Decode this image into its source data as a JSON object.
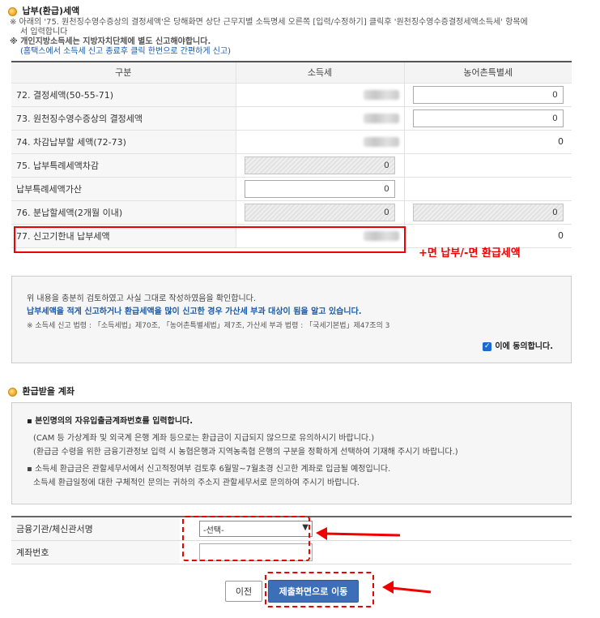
{
  "section1": {
    "title": "납부(환급)세액",
    "note1a": "※ 아래의 '75. 원천징수영수증상의 결정세액'은 당해화면 상단 근무지별 소득명세 오른쪽 [입력/수정하기] 클릭후 '원천징수영수증결정세액소득세' 항목에",
    "note1b": "서 입력합니다",
    "note2": "※ 개인지방소득세는 지방자치단체에 별도 신고해야합니다.",
    "note3": "(홈택스에서 소득세 신고 종료후 클릭 한번으로 간편하게 신고)"
  },
  "table": {
    "headers": [
      "구분",
      "소득세",
      "농어촌특별세"
    ],
    "rows": [
      {
        "label": "72. 결정세액(50-55-71)",
        "col3": "0"
      },
      {
        "label": "73. 원천징수영수증상의 결정세액",
        "col3": "0"
      },
      {
        "label": "74. 차감납부할 세액(72-73)",
        "col3": "0"
      },
      {
        "label": "75. 납부특례세액차감",
        "col2": "0"
      },
      {
        "label": "납부특례세액가산",
        "col2": "0"
      },
      {
        "label": "76. 분납할세액(2개월 이내)",
        "col2": "0",
        "col3": "0"
      },
      {
        "label": "77. 신고기한내 납부세액",
        "col3": "0"
      }
    ]
  },
  "annotation_note": "+면 납부/-면 환급세액",
  "confirm": {
    "line1": "위 내용을 충분히 검토하였고 사실 그대로 작성하였음을 확인합니다.",
    "line2": "납부세액을 적게 신고하거나 환급세액을 많이 신고한 경우 가산세 부과 대상이 됨을 알고 있습니다.",
    "line3": "※ 소득세 신고 법령 : 「소득세법」제70조, 「농어촌특별세법」제7조, 가산세 부과 법령 : 「국세기본법」제47조의 3",
    "agree_label": "이에 동의합니다."
  },
  "section2": {
    "title": "환급받을 계좌"
  },
  "notice": {
    "bullet1": "▪ 본인명의의 자유입출금계좌번호를 입력합니다.",
    "line1": "(CAM 등 가상계좌 및 외국계 은행 계좌 등으로는 환급금이 지급되지 않으므로 유의하시기 바랍니다.)",
    "line2": "(환급금 수령을 위한 금융기관정보 입력 시 농협은행과 지역농축협 은행의 구분을 정확하게 선택하여 기재해 주시기 바랍니다.)",
    "bullet2": "▪ 소득세 환급금은 관할세무서에서 신고적정여부 검토후 6월말~7월초경 신고한 계좌로 입금될 예정입니다.",
    "line3": "소득세 환급일정에 대한 구체적인 문의는 귀하의 주소지 관할세무서로 문의하여 주시기 바랍니다."
  },
  "account": {
    "bank_label": "금융기관/체신관서명",
    "bank_selected": "-선택-",
    "acct_label": "계좌번호",
    "acct_value": ""
  },
  "buttons": {
    "prev": "이전",
    "submit": "제출화면으로 이동"
  },
  "colors": {
    "accent": "#3d6fb8",
    "annotation": "#e00000"
  },
  "icons": {
    "section": "bullet-circle-icon",
    "arrow": "red-arrow-icon",
    "check": "checkbox-checked-icon"
  }
}
